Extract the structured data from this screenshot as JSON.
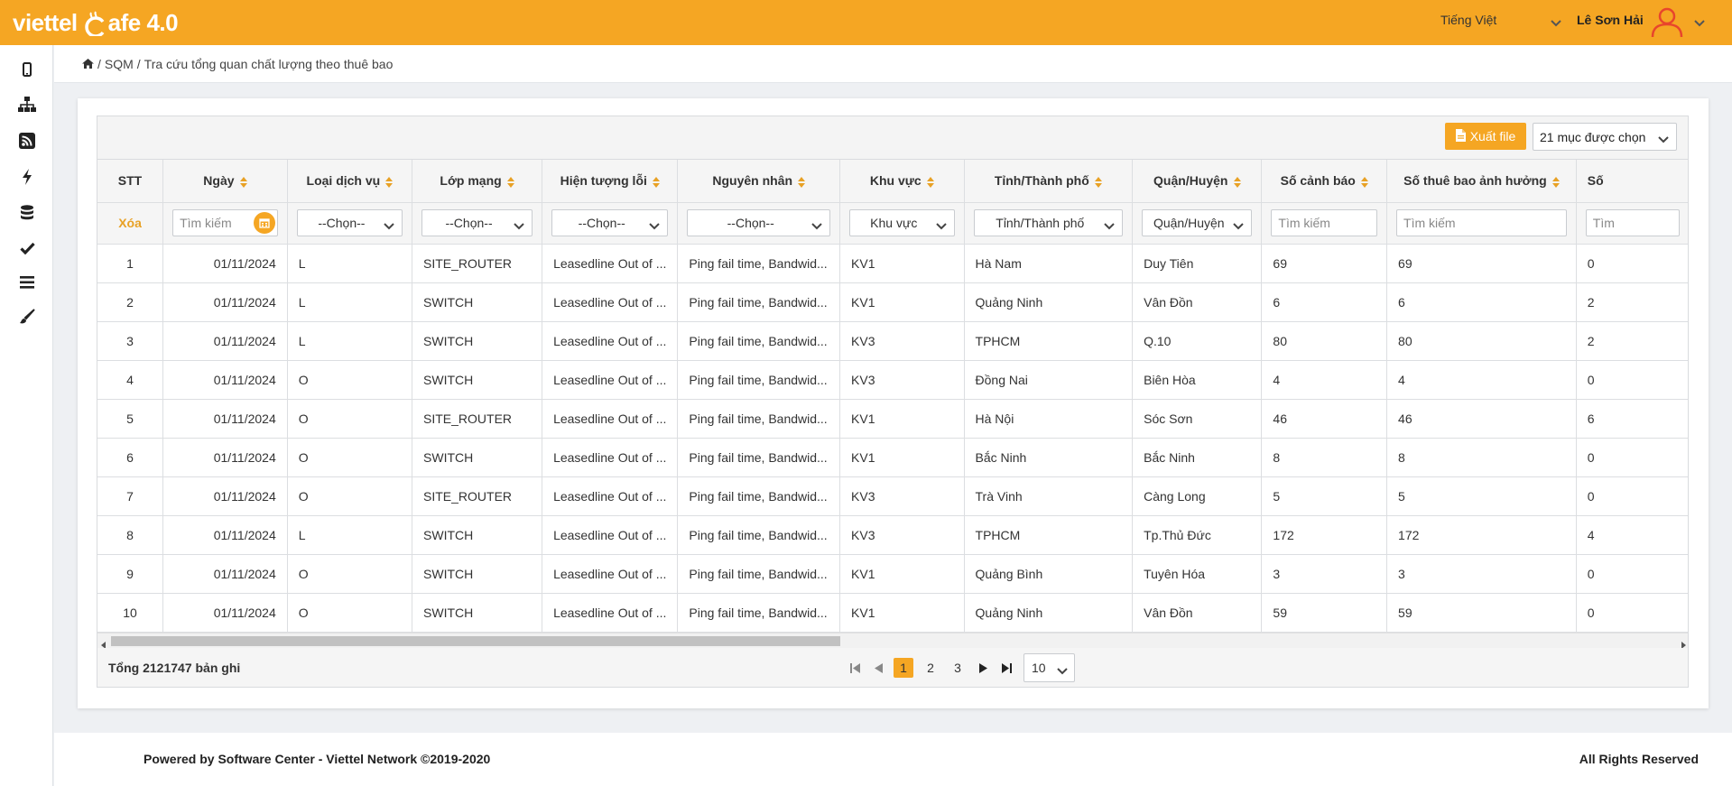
{
  "brand": {
    "logo_text": "viettel",
    "logo_suffix": "afe 4.0",
    "primary_color": "#f5a623"
  },
  "header": {
    "language": "Tiếng Việt",
    "user_name": "Lê Sơn Hải"
  },
  "sidebar": {
    "items": [
      {
        "icon": "mobile-icon"
      },
      {
        "icon": "sitemap-icon"
      },
      {
        "icon": "rss-icon"
      },
      {
        "icon": "bolt-icon"
      },
      {
        "icon": "database-icon"
      },
      {
        "icon": "check-icon"
      },
      {
        "icon": "bars-icon"
      },
      {
        "icon": "paint-brush-icon"
      }
    ]
  },
  "breadcrumb": {
    "items": [
      "SQM",
      "Tra cứu tổng quan chất lượng theo thuê bao"
    ]
  },
  "toolbar": {
    "export_label": "Xuất file",
    "columns_selected": "21 mục được chọn"
  },
  "table": {
    "columns": [
      "STT",
      "Ngày",
      "Loại dịch vụ",
      "Lớp mạng",
      "Hiện tượng lỗi",
      "Nguyên nhân",
      "Khu vực",
      "Tỉnh/Thành phố",
      "Quận/Huyện",
      "Số cảnh báo",
      "Số thuê bao ảnh hưởng",
      "Số"
    ],
    "filters": {
      "clear_label": "Xóa",
      "date_placeholder": "Tìm kiếm",
      "service": "--Chọn--",
      "network": "--Chọn--",
      "error": "--Chọn--",
      "cause": "--Chọn--",
      "area": "Khu vực",
      "province": "Tỉnh/Thành phố",
      "district": "Quận/Huyện",
      "alerts_placeholder": "Tìm kiếm",
      "subs_placeholder": "Tìm kiếm",
      "last_placeholder": "Tìm"
    },
    "rows": [
      [
        "1",
        "01/11/2024",
        "L",
        "SITE_ROUTER",
        "Leasedline Out of ...",
        "Ping fail time, Bandwid...",
        "KV1",
        "Hà Nam",
        "Duy Tiên",
        "69",
        "69",
        "0"
      ],
      [
        "2",
        "01/11/2024",
        "L",
        "SWITCH",
        "Leasedline Out of ...",
        "Ping fail time, Bandwid...",
        "KV1",
        "Quảng Ninh",
        "Vân Đồn",
        "6",
        "6",
        "2"
      ],
      [
        "3",
        "01/11/2024",
        "L",
        "SWITCH",
        "Leasedline Out of ...",
        "Ping fail time, Bandwid...",
        "KV3",
        "TPHCM",
        "Q.10",
        "80",
        "80",
        "2"
      ],
      [
        "4",
        "01/11/2024",
        "O",
        "SWITCH",
        "Leasedline Out of ...",
        "Ping fail time, Bandwid...",
        "KV3",
        "Đồng Nai",
        "Biên Hòa",
        "4",
        "4",
        "0"
      ],
      [
        "5",
        "01/11/2024",
        "O",
        "SITE_ROUTER",
        "Leasedline Out of ...",
        "Ping fail time, Bandwid...",
        "KV1",
        "Hà Nội",
        "Sóc Sơn",
        "46",
        "46",
        "6"
      ],
      [
        "6",
        "01/11/2024",
        "O",
        "SWITCH",
        "Leasedline Out of ...",
        "Ping fail time, Bandwid...",
        "KV1",
        "Bắc Ninh",
        "Bắc Ninh",
        "8",
        "8",
        "0"
      ],
      [
        "7",
        "01/11/2024",
        "O",
        "SITE_ROUTER",
        "Leasedline Out of ...",
        "Ping fail time, Bandwid...",
        "KV3",
        "Trà Vinh",
        "Càng Long",
        "5",
        "5",
        "0"
      ],
      [
        "8",
        "01/11/2024",
        "L",
        "SWITCH",
        "Leasedline Out of ...",
        "Ping fail time, Bandwid...",
        "KV3",
        "TPHCM",
        "Tp.Thủ Đức",
        "172",
        "172",
        "4"
      ],
      [
        "9",
        "01/11/2024",
        "O",
        "SWITCH",
        "Leasedline Out of ...",
        "Ping fail time, Bandwid...",
        "KV1",
        "Quảng Bình",
        "Tuyên Hóa",
        "3",
        "3",
        "0"
      ],
      [
        "10",
        "01/11/2024",
        "O",
        "SWITCH",
        "Leasedline Out of ...",
        "Ping fail time, Bandwid...",
        "KV1",
        "Quảng Ninh",
        "Vân Đồn",
        "59",
        "59",
        "0"
      ]
    ]
  },
  "pagination": {
    "total_label": "Tổng 2121747 bản ghi",
    "pages": [
      "1",
      "2",
      "3"
    ],
    "active_page": "1",
    "page_size": "10"
  },
  "footer": {
    "left": "Powered by Software Center - Viettel Network ©2019-2020",
    "right": "All Rights Reserved"
  }
}
